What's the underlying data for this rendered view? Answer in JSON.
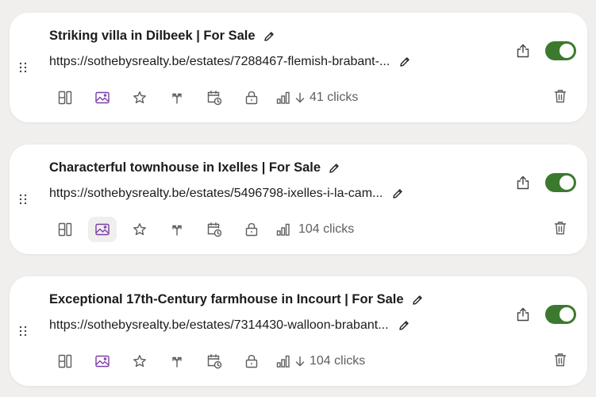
{
  "links": [
    {
      "title": "Striking villa in Dilbeek | For Sale",
      "url": "https://sothebysrealty.be/estates/7288467-flemish-brabant-...",
      "clicks": "41 clicks",
      "show_trend_arrow": true,
      "active_tool": "",
      "enabled": true
    },
    {
      "title": "Characterful townhouse in Ixelles | For Sale",
      "url": "https://sothebysrealty.be/estates/5496798-ixelles-i-la-cam...",
      "clicks": "104 clicks",
      "show_trend_arrow": false,
      "active_tool": "thumbnail",
      "enabled": true
    },
    {
      "title": "Exceptional 17th-Century farmhouse in Incourt | For Sale",
      "url": "https://sothebysrealty.be/estates/7314430-walloon-brabant...",
      "clicks": "104 clicks",
      "show_trend_arrow": true,
      "active_tool": "",
      "enabled": true
    }
  ],
  "tools": [
    "layout-icon",
    "thumbnail-icon",
    "star-icon",
    "redirect-icon",
    "schedule-icon",
    "lock-icon"
  ],
  "colors": {
    "background": "#f0efed",
    "card": "#ffffff",
    "toggle_on": "#3b7a2e",
    "thumbnail_accent": "#7b3fa8",
    "icon_gray": "#5f5f5f"
  }
}
